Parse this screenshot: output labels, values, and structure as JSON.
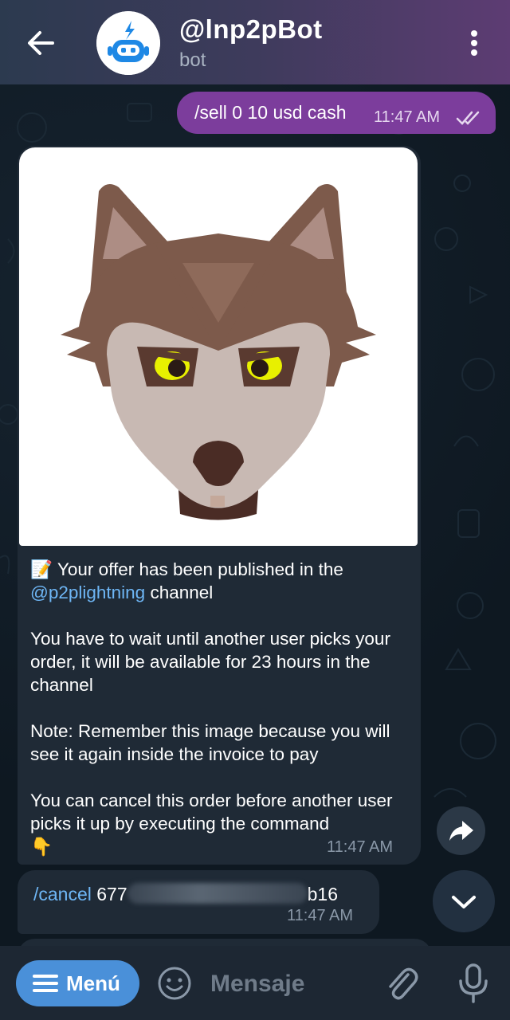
{
  "header": {
    "title": "@lnp2pBot",
    "subtitle": "bot",
    "icons": {
      "back": "arrow-left-icon",
      "avatar": "robot-avatar",
      "more": "more-vertical-icon"
    }
  },
  "messages": {
    "outgoing": {
      "text": "/sell 0 10 usd cash",
      "time": "11:47 AM",
      "status_icon": "double-check-icon"
    },
    "offer": {
      "image": "wolf-image",
      "line1_emoji": "📝",
      "line1": "Your offer has been published in the",
      "channel_link": "@p2plightning",
      "channel_suffix": "channel",
      "para2": "You have to wait until another user picks your order, it will be available for 23 hours in the channel",
      "para3": "Note: Remember this image because you will see it again inside the invoice to pay",
      "para4": "You can cancel this order before another user picks it up by executing the command",
      "pointer_emoji": "👇",
      "time": "11:47 AM"
    },
    "cancel": {
      "command": "/cancel",
      "id_prefix": "677",
      "id_suffix": "b16",
      "time": "11:47 AM"
    }
  },
  "floating": {
    "share_icon": "share-arrow-icon",
    "scroll_down_icon": "chevron-down-icon"
  },
  "bottom_bar": {
    "menu_label": "Menú",
    "input_placeholder": "Mensaje",
    "icons": {
      "menu": "hamburger-icon",
      "emoji": "smiley-icon",
      "attach": "paperclip-icon",
      "mic": "microphone-icon"
    }
  },
  "colors": {
    "header_gradient_start": "#2c3a4f",
    "header_gradient_end": "#5d3c73",
    "outgoing_bubble": "#7c3d9c",
    "incoming_bubble": "#1f2a36",
    "link": "#6eb6f5",
    "menu_button": "#4a90d9"
  }
}
